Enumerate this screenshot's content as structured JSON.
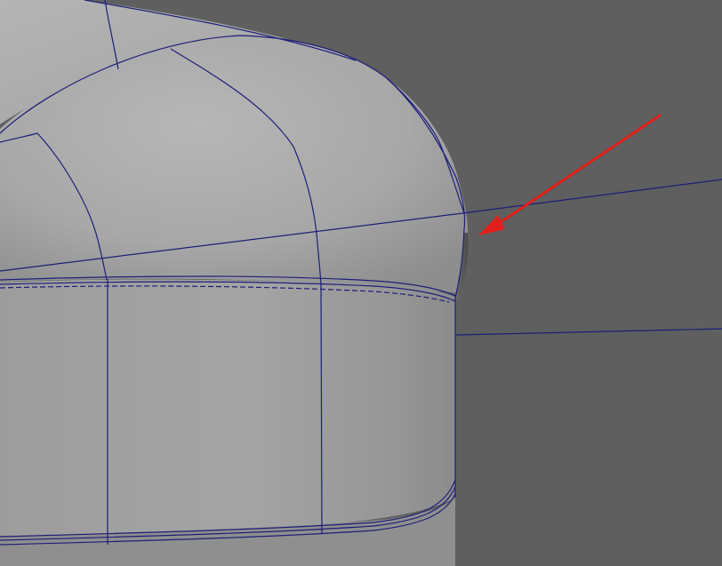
{
  "viewport": {
    "background_color": "#5f5f5f",
    "wire_color": "#1e1e7a",
    "annotation_color": "#e0201a",
    "highlight_color": "#b8b8b8",
    "shadow_color": "#8a8a8a",
    "annotation_icon": "arrow-icon"
  }
}
